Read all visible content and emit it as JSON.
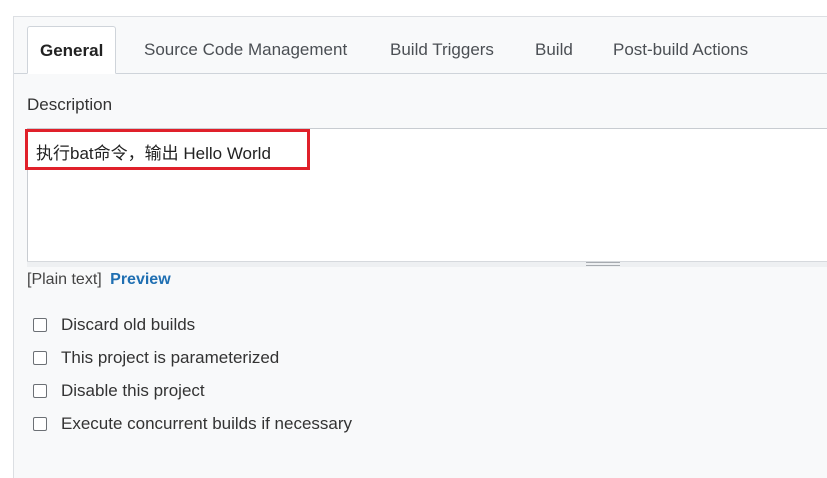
{
  "tabs": [
    {
      "label": "General",
      "active": true
    },
    {
      "label": "Source Code Management",
      "active": false
    },
    {
      "label": "Build Triggers",
      "active": false
    },
    {
      "label": "Build",
      "active": false
    },
    {
      "label": "Post-build Actions",
      "active": false
    }
  ],
  "description": {
    "label": "Description",
    "value": "执行bat命令，输出 Hello World",
    "format_label": "[Plain text]",
    "preview_link": "Preview"
  },
  "options": [
    {
      "label": "Discard old builds",
      "checked": false
    },
    {
      "label": "This project is parameterized",
      "checked": false
    },
    {
      "label": "Disable this project",
      "checked": false
    },
    {
      "label": "Execute concurrent builds if necessary",
      "checked": false
    }
  ],
  "colors": {
    "highlight": "#e0202a",
    "link": "#1f6fb2"
  }
}
